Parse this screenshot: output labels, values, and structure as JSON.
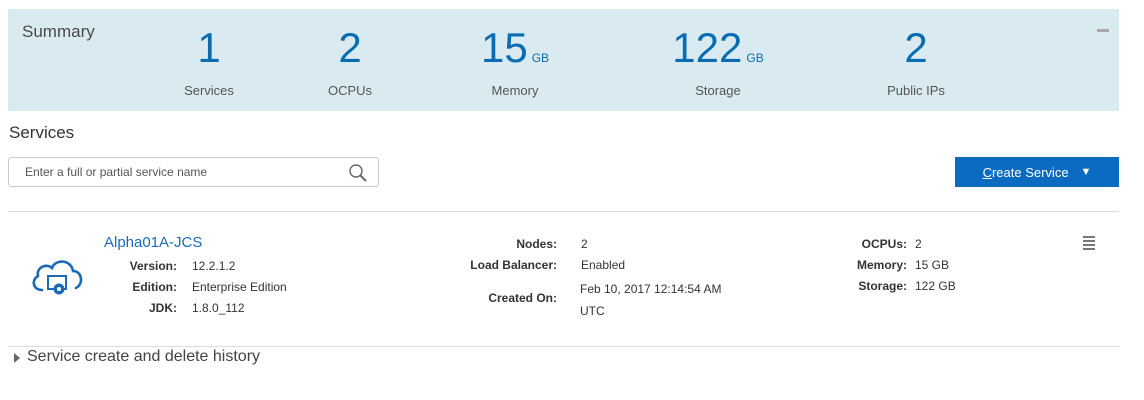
{
  "summary": {
    "title": "Summary",
    "metrics": [
      {
        "value": "1",
        "unit": "",
        "label": "Services"
      },
      {
        "value": "2",
        "unit": "",
        "label": "OCPUs"
      },
      {
        "value": "15",
        "unit": "GB",
        "label": "Memory"
      },
      {
        "value": "122",
        "unit": "GB",
        "label": "Storage"
      },
      {
        "value": "2",
        "unit": "",
        "label": "Public IPs"
      }
    ]
  },
  "services": {
    "heading": "Services",
    "search_placeholder": "Enter a full or partial service name",
    "create_button": {
      "first_letter": "C",
      "rest": "reate Service"
    },
    "items": [
      {
        "name": "Alpha01A-JCS",
        "details_left": [
          {
            "key": "Version:",
            "value": "12.2.1.2"
          },
          {
            "key": "Edition:",
            "value": "Enterprise Edition"
          },
          {
            "key": "JDK:",
            "value": "1.8.0_112"
          }
        ],
        "details_mid": [
          {
            "key": "Nodes:",
            "value": "2"
          },
          {
            "key": "Load Balancer:",
            "value": "Enabled"
          }
        ],
        "created_on": {
          "key": "Created On:",
          "line1": "Feb 10, 2017 12:14:54 AM",
          "line2": "UTC"
        },
        "details_right": [
          {
            "key": "OCPUs:",
            "value": "2"
          },
          {
            "key": "Memory:",
            "value": "15 GB"
          },
          {
            "key": "Storage:",
            "value": "122 GB"
          }
        ]
      }
    ],
    "history_label": "Service create and delete history"
  },
  "colors": {
    "summary_bg": "#d9ebf1",
    "accent_blue": "#0a6db1",
    "button_blue": "#0a6bc0",
    "link_blue": "#1a6ab8"
  },
  "icons": {
    "search": "search-icon",
    "cloud": "cloud-service-icon",
    "menu": "hamburger-menu-icon",
    "collapse": "minus-icon",
    "expand": "triangle-right-icon",
    "dropdown": "caret-down-icon"
  }
}
